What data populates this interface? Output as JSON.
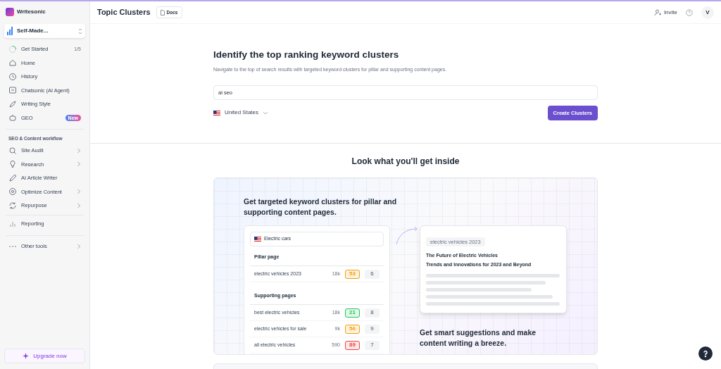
{
  "sidebar": {
    "brand": "Writesonic",
    "workspace": "Self-Made...",
    "items": [
      {
        "label": "Get Started",
        "progress": "1/5",
        "has_submenu": false
      },
      {
        "label": "Home",
        "has_submenu": false
      },
      {
        "label": "History",
        "has_submenu": false
      },
      {
        "label": "Chatsonic (AI Agent)",
        "has_submenu": false
      },
      {
        "label": "Writing Style",
        "has_submenu": false
      },
      {
        "label": "GEO",
        "badge": "New",
        "has_submenu": false
      }
    ],
    "section_title": "SEO & Content workflow",
    "section_items": [
      {
        "label": "Site Audit",
        "has_submenu": true
      },
      {
        "label": "Research",
        "has_submenu": true
      },
      {
        "label": "AI Article Writer",
        "has_submenu": false
      },
      {
        "label": "Optimize Content",
        "has_submenu": true
      },
      {
        "label": "Repurpose",
        "has_submenu": true
      }
    ],
    "reporting": "Reporting",
    "other": {
      "label": "Other tools",
      "has_submenu": true
    },
    "upgrade": "Upgrade now"
  },
  "header": {
    "title": "Topic Clusters",
    "docs": "Docs",
    "invite": "Invite",
    "avatar": "V"
  },
  "hero": {
    "title": "Identify the top ranking keyword clusters",
    "subtitle": "Navigate to the top of search results with targeted keyword clusters for pillar and supporting content pages.",
    "keyword": "ai seo",
    "country": "United States",
    "button": "Create Clusters"
  },
  "preview": {
    "title": "Look what you'll get inside",
    "headline": "Get targeted keyword clusters for pillar and supporting content pages.",
    "search": "Electric cars",
    "pillar_title": "Pillar page",
    "pillar": [
      {
        "keyword": "electric vehicles 2023",
        "volume": "18k",
        "score": "53",
        "color": "#f59e0b",
        "count": "6"
      }
    ],
    "supporting_title": "Supporting pages",
    "supporting": [
      {
        "keyword": "best electric vehicles",
        "volume": "18k",
        "score": "21",
        "color": "#22c55e",
        "count": "8"
      },
      {
        "keyword": "electric vehicles for sale",
        "volume": "9k",
        "score": "56",
        "color": "#f59e0b",
        "count": "9"
      },
      {
        "keyword": "all electric vehicles",
        "volume": "590",
        "score": "89",
        "color": "#ef4444",
        "count": "7"
      }
    ],
    "article_tag": "electric vehicles 2023",
    "article_title": "The Future of Electric Vehicles",
    "article_subtitle": "Trends and Innovations for 2023 and Beyond",
    "caption": "Get smart suggestions and make content writing a breeze."
  }
}
